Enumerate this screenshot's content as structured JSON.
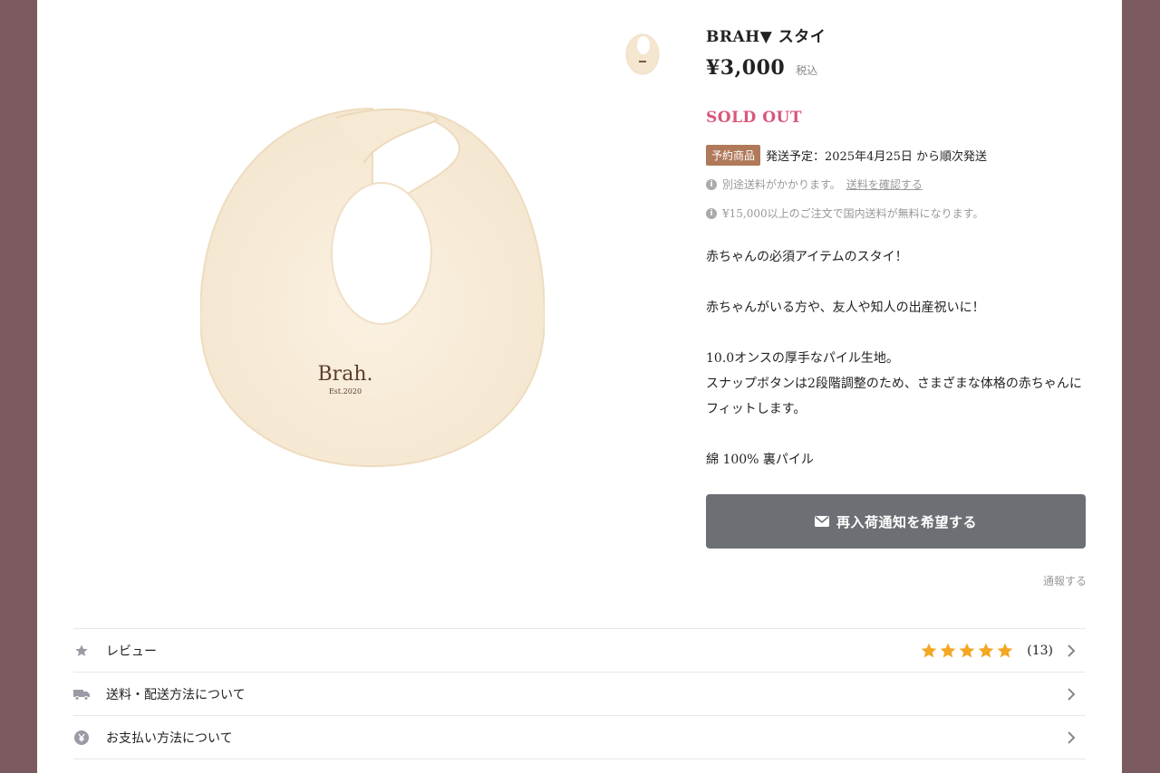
{
  "product": {
    "title": "BRAH▼ スタイ",
    "price": "¥3,000",
    "tax_label": "税込",
    "status": "SOLD OUT",
    "preorder_badge": "予約商品",
    "shipping_schedule": "発送予定：2025年4月25日 から順次発送",
    "shipping_note": "別途送料がかかります。",
    "shipping_link": "送料を確認する",
    "free_shipping_note": "¥15,000以上のご注文で国内送料が無料になります。",
    "image_logo_text": "Brah.",
    "image_logo_sub": "Est.2020"
  },
  "description": [
    "赤ちゃんの必須アイテムのスタイ！",
    "",
    "赤ちゃんがいる方や、友人や知人の出産祝いに！",
    "",
    "10.0オンスの厚手なパイル生地。",
    "スナップボタンは2段階調整のため、さまざまな体格の赤ちゃんに",
    "フィットします。",
    "",
    "綿 100% 裏パイル"
  ],
  "actions": {
    "notify_label": "再入荷通知を希望する",
    "report_label": "通報する"
  },
  "rows": [
    {
      "icon": "star-icon",
      "label": "レビュー",
      "rating": 5,
      "count": "(13)"
    },
    {
      "icon": "truck-icon",
      "label": "送料・配送方法について"
    },
    {
      "icon": "yen-icon",
      "label": "お支払い方法について"
    }
  ],
  "colors": {
    "background": "#7a5a5e",
    "sold_out": "#d9577a",
    "badge": "#b07a5a",
    "button": "#6c6f74",
    "star": "#f5a623"
  }
}
